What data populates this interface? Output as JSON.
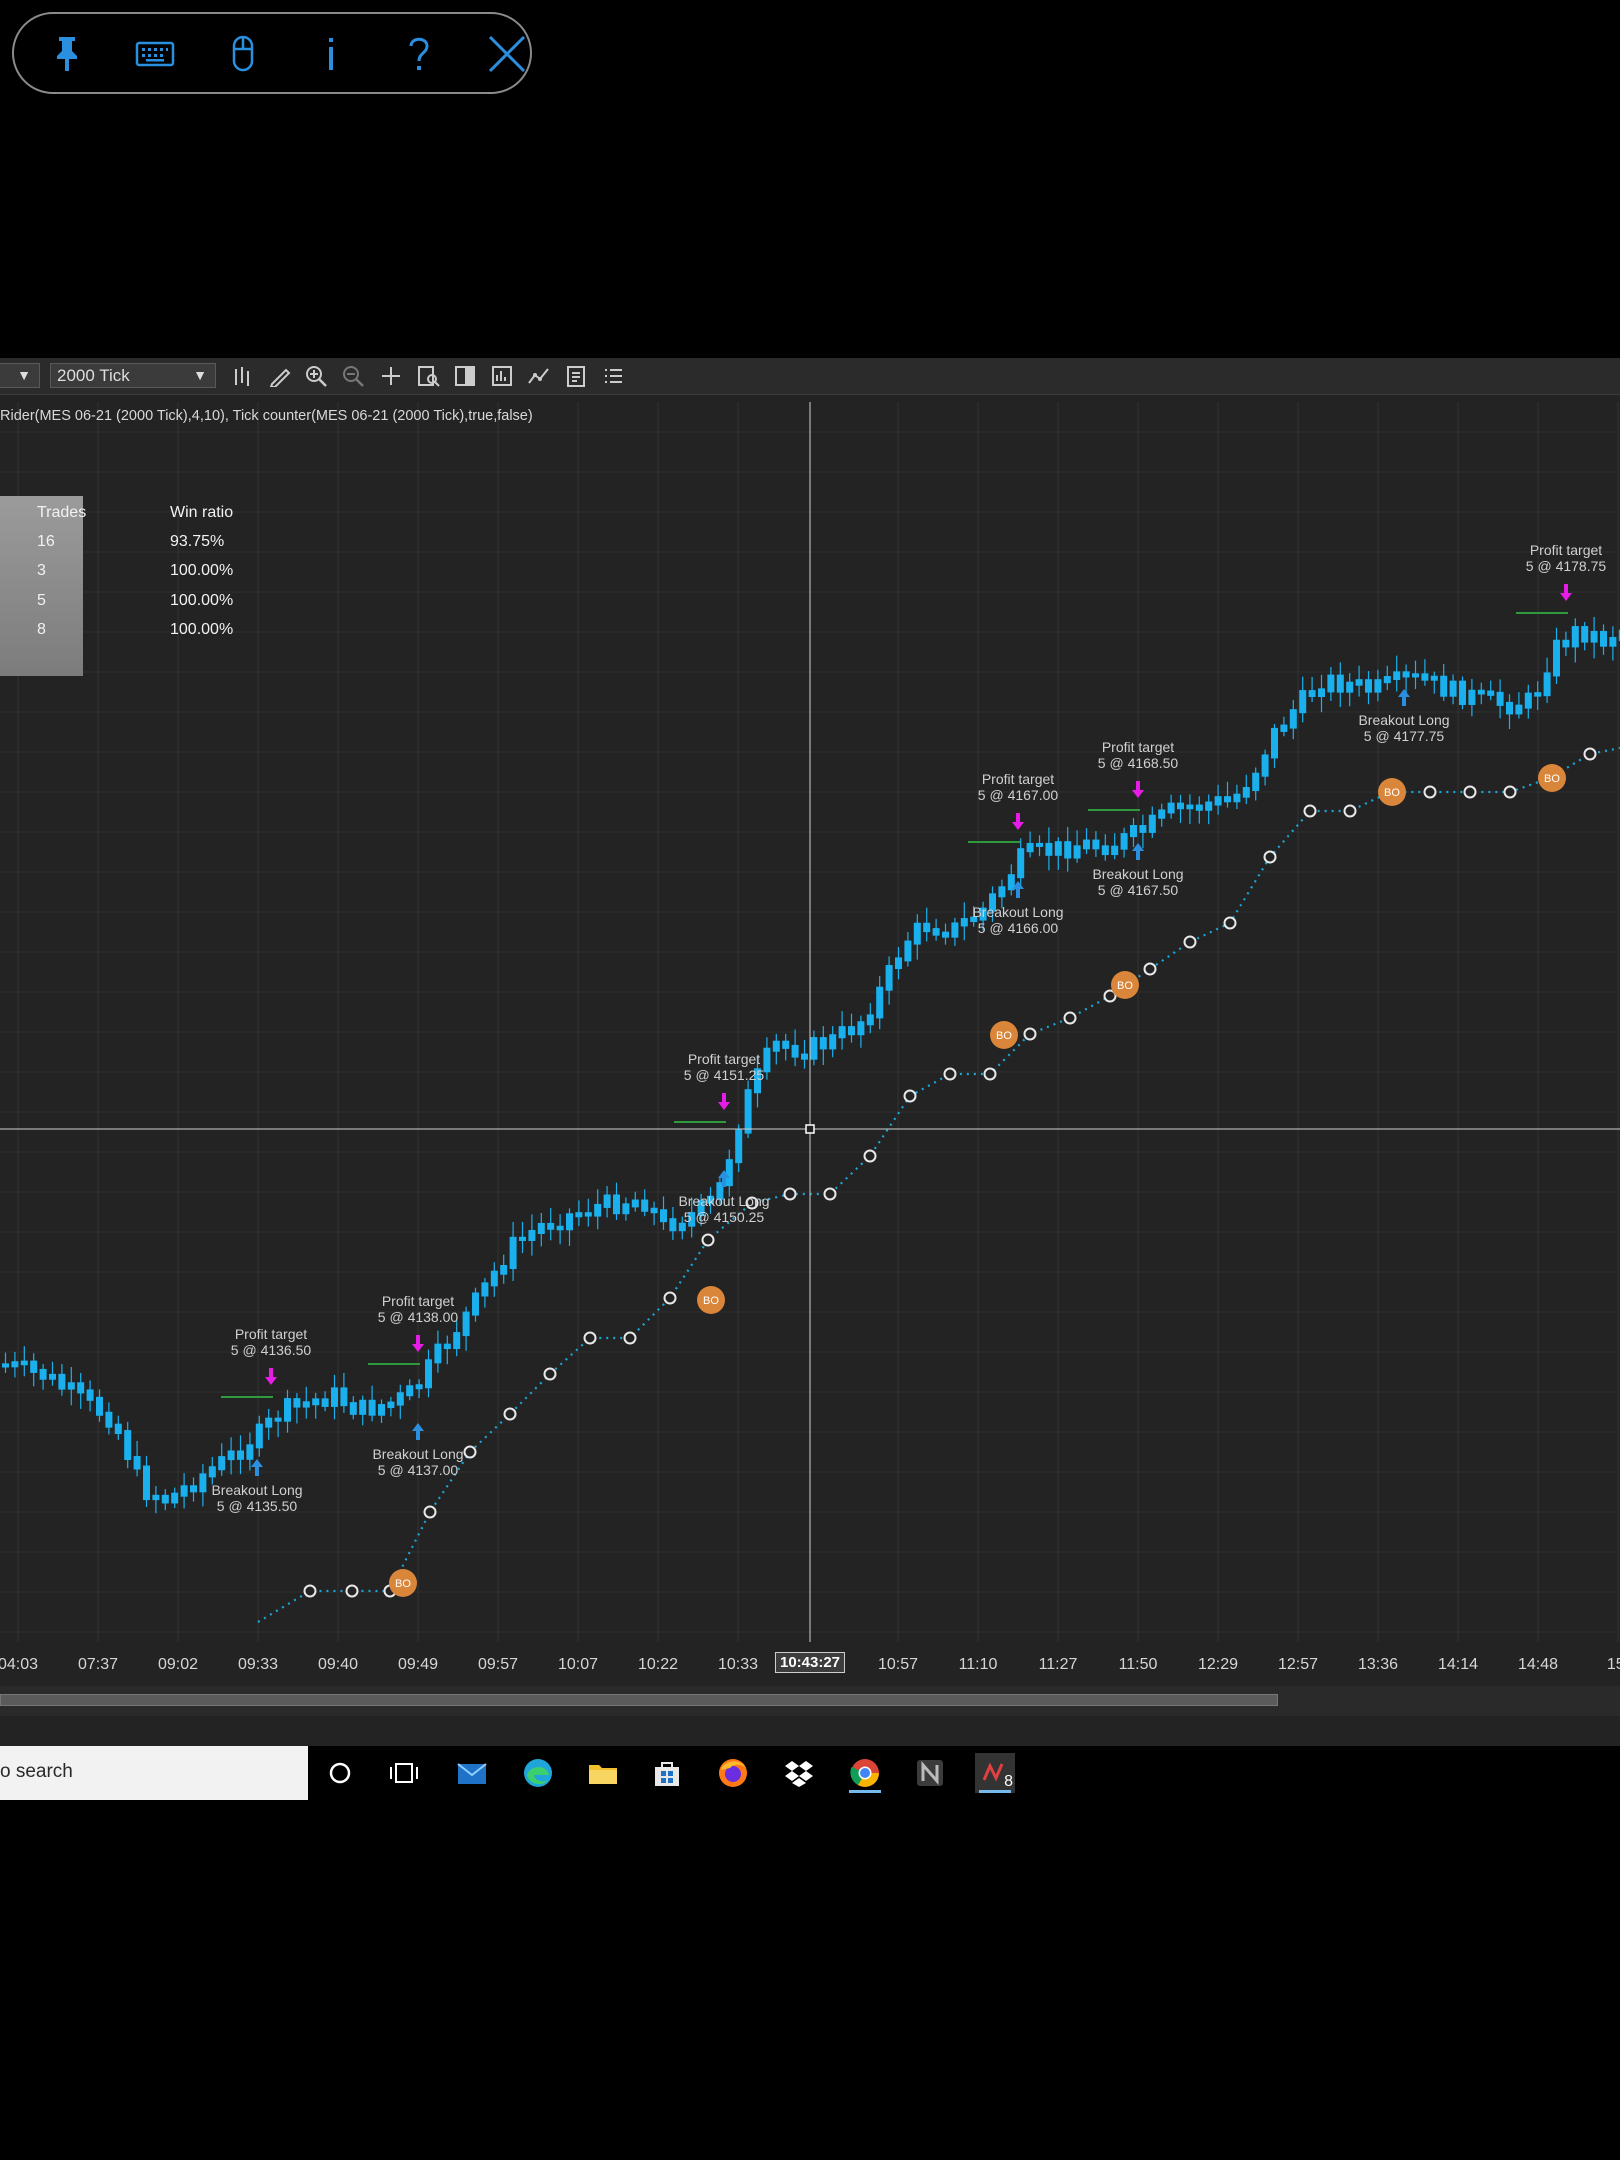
{
  "remote_bar": {
    "buttons": [
      "pin-icon",
      "keyboard-icon",
      "mouse-icon",
      "info-icon",
      "help-icon",
      "close-icon"
    ]
  },
  "toolbar": {
    "instrument_dropdown": "",
    "timeframe_dropdown": "2000 Tick",
    "tools": [
      "bar-type-icon",
      "drawing-tool-icon",
      "zoom-in-icon",
      "zoom-out-icon",
      "crosshair-icon",
      "data-box-icon",
      "chart-trader-icon",
      "properties-icon",
      "indicators-icon",
      "strategies-icon",
      "list-icon"
    ]
  },
  "indicator_label": "Rider(MES 06-21 (2000 Tick),4,10), Tick counter(MES 06-21 (2000 Tick),true,false)",
  "stats": {
    "headers": [
      "Trades",
      "Win ratio"
    ],
    "rows": [
      [
        "16",
        "93.75%"
      ],
      [
        "3",
        "100.00%"
      ],
      [
        "5",
        "100.00%"
      ],
      [
        "8",
        "100.00%"
      ]
    ]
  },
  "colors": {
    "candle": "#1ab0ee",
    "trail": "#1aa6d6",
    "profit_arrow": "#e81ce8",
    "entry_arrow": "#2b8fe0",
    "target_line": "#2e9a3c",
    "bo_marker": "#d9853a"
  },
  "chart_data": {
    "type": "candlestick",
    "instrument": "MES 06-21",
    "timeframe": "2000 Tick",
    "time_ticks": [
      "04:03",
      "07:37",
      "09:02",
      "09:33",
      "09:40",
      "09:49",
      "09:57",
      "10:07",
      "10:22",
      "10:33",
      "10:57",
      "11:10",
      "11:27",
      "11:50",
      "12:29",
      "12:57",
      "13:36",
      "14:14",
      "14:48",
      "15:"
    ],
    "cursor_time": "10:43:27",
    "annotations": [
      {
        "label": "Breakout Long",
        "price_text": "5 @ 4135.50",
        "kind": "entry"
      },
      {
        "label": "Profit target",
        "price_text": "5 @ 4136.50",
        "kind": "exit"
      },
      {
        "label": "Breakout Long",
        "price_text": "5 @ 4137.00",
        "kind": "entry"
      },
      {
        "label": "Profit target",
        "price_text": "5 @ 4138.00",
        "kind": "exit"
      },
      {
        "label": "Breakout Long",
        "price_text": "5 @ 4150.25",
        "kind": "entry"
      },
      {
        "label": "Profit target",
        "price_text": "5 @ 4151.25",
        "kind": "exit"
      },
      {
        "label": "Breakout Long",
        "price_text": "5 @ 4166.00",
        "kind": "entry"
      },
      {
        "label": "Profit target",
        "price_text": "5 @ 4167.00",
        "kind": "exit"
      },
      {
        "label": "Breakout Long",
        "price_text": "5 @ 4167.50",
        "kind": "entry"
      },
      {
        "label": "Profit target",
        "price_text": "5 @ 4168.50",
        "kind": "exit"
      },
      {
        "label": "Breakout Long",
        "price_text": "5 @ 4177.75",
        "kind": "entry"
      },
      {
        "label": "Profit target",
        "price_text": "5 @ 4178.75",
        "kind": "exit"
      }
    ],
    "bo_marker_text": "BO"
  },
  "taskbar": {
    "search_text": "o search",
    "apps": [
      "cortana-icon",
      "task-view-icon",
      "mail-icon",
      "edge-icon",
      "file-explorer-icon",
      "store-icon",
      "firefox-icon",
      "dropbox-icon",
      "chrome-icon",
      "ninjatrader-icon",
      "trading-app-icon"
    ],
    "badge": "8"
  }
}
